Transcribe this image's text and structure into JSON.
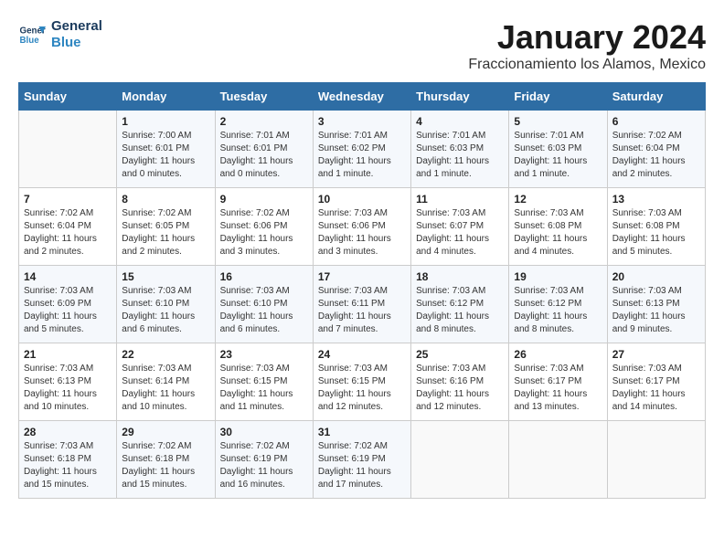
{
  "logo": {
    "line1": "General",
    "line2": "Blue"
  },
  "title": "January 2024",
  "subtitle": "Fraccionamiento los Alamos, Mexico",
  "days_header": [
    "Sunday",
    "Monday",
    "Tuesday",
    "Wednesday",
    "Thursday",
    "Friday",
    "Saturday"
  ],
  "weeks": [
    [
      {
        "day": "",
        "info": ""
      },
      {
        "day": "1",
        "info": "Sunrise: 7:00 AM\nSunset: 6:01 PM\nDaylight: 11 hours\nand 0 minutes."
      },
      {
        "day": "2",
        "info": "Sunrise: 7:01 AM\nSunset: 6:01 PM\nDaylight: 11 hours\nand 0 minutes."
      },
      {
        "day": "3",
        "info": "Sunrise: 7:01 AM\nSunset: 6:02 PM\nDaylight: 11 hours\nand 1 minute."
      },
      {
        "day": "4",
        "info": "Sunrise: 7:01 AM\nSunset: 6:03 PM\nDaylight: 11 hours\nand 1 minute."
      },
      {
        "day": "5",
        "info": "Sunrise: 7:01 AM\nSunset: 6:03 PM\nDaylight: 11 hours\nand 1 minute."
      },
      {
        "day": "6",
        "info": "Sunrise: 7:02 AM\nSunset: 6:04 PM\nDaylight: 11 hours\nand 2 minutes."
      }
    ],
    [
      {
        "day": "7",
        "info": "Sunrise: 7:02 AM\nSunset: 6:04 PM\nDaylight: 11 hours\nand 2 minutes."
      },
      {
        "day": "8",
        "info": "Sunrise: 7:02 AM\nSunset: 6:05 PM\nDaylight: 11 hours\nand 2 minutes."
      },
      {
        "day": "9",
        "info": "Sunrise: 7:02 AM\nSunset: 6:06 PM\nDaylight: 11 hours\nand 3 minutes."
      },
      {
        "day": "10",
        "info": "Sunrise: 7:03 AM\nSunset: 6:06 PM\nDaylight: 11 hours\nand 3 minutes."
      },
      {
        "day": "11",
        "info": "Sunrise: 7:03 AM\nSunset: 6:07 PM\nDaylight: 11 hours\nand 4 minutes."
      },
      {
        "day": "12",
        "info": "Sunrise: 7:03 AM\nSunset: 6:08 PM\nDaylight: 11 hours\nand 4 minutes."
      },
      {
        "day": "13",
        "info": "Sunrise: 7:03 AM\nSunset: 6:08 PM\nDaylight: 11 hours\nand 5 minutes."
      }
    ],
    [
      {
        "day": "14",
        "info": "Sunrise: 7:03 AM\nSunset: 6:09 PM\nDaylight: 11 hours\nand 5 minutes."
      },
      {
        "day": "15",
        "info": "Sunrise: 7:03 AM\nSunset: 6:10 PM\nDaylight: 11 hours\nand 6 minutes."
      },
      {
        "day": "16",
        "info": "Sunrise: 7:03 AM\nSunset: 6:10 PM\nDaylight: 11 hours\nand 6 minutes."
      },
      {
        "day": "17",
        "info": "Sunrise: 7:03 AM\nSunset: 6:11 PM\nDaylight: 11 hours\nand 7 minutes."
      },
      {
        "day": "18",
        "info": "Sunrise: 7:03 AM\nSunset: 6:12 PM\nDaylight: 11 hours\nand 8 minutes."
      },
      {
        "day": "19",
        "info": "Sunrise: 7:03 AM\nSunset: 6:12 PM\nDaylight: 11 hours\nand 8 minutes."
      },
      {
        "day": "20",
        "info": "Sunrise: 7:03 AM\nSunset: 6:13 PM\nDaylight: 11 hours\nand 9 minutes."
      }
    ],
    [
      {
        "day": "21",
        "info": "Sunrise: 7:03 AM\nSunset: 6:13 PM\nDaylight: 11 hours\nand 10 minutes."
      },
      {
        "day": "22",
        "info": "Sunrise: 7:03 AM\nSunset: 6:14 PM\nDaylight: 11 hours\nand 10 minutes."
      },
      {
        "day": "23",
        "info": "Sunrise: 7:03 AM\nSunset: 6:15 PM\nDaylight: 11 hours\nand 11 minutes."
      },
      {
        "day": "24",
        "info": "Sunrise: 7:03 AM\nSunset: 6:15 PM\nDaylight: 11 hours\nand 12 minutes."
      },
      {
        "day": "25",
        "info": "Sunrise: 7:03 AM\nSunset: 6:16 PM\nDaylight: 11 hours\nand 12 minutes."
      },
      {
        "day": "26",
        "info": "Sunrise: 7:03 AM\nSunset: 6:17 PM\nDaylight: 11 hours\nand 13 minutes."
      },
      {
        "day": "27",
        "info": "Sunrise: 7:03 AM\nSunset: 6:17 PM\nDaylight: 11 hours\nand 14 minutes."
      }
    ],
    [
      {
        "day": "28",
        "info": "Sunrise: 7:03 AM\nSunset: 6:18 PM\nDaylight: 11 hours\nand 15 minutes."
      },
      {
        "day": "29",
        "info": "Sunrise: 7:02 AM\nSunset: 6:18 PM\nDaylight: 11 hours\nand 15 minutes."
      },
      {
        "day": "30",
        "info": "Sunrise: 7:02 AM\nSunset: 6:19 PM\nDaylight: 11 hours\nand 16 minutes."
      },
      {
        "day": "31",
        "info": "Sunrise: 7:02 AM\nSunset: 6:19 PM\nDaylight: 11 hours\nand 17 minutes."
      },
      {
        "day": "",
        "info": ""
      },
      {
        "day": "",
        "info": ""
      },
      {
        "day": "",
        "info": ""
      }
    ]
  ]
}
